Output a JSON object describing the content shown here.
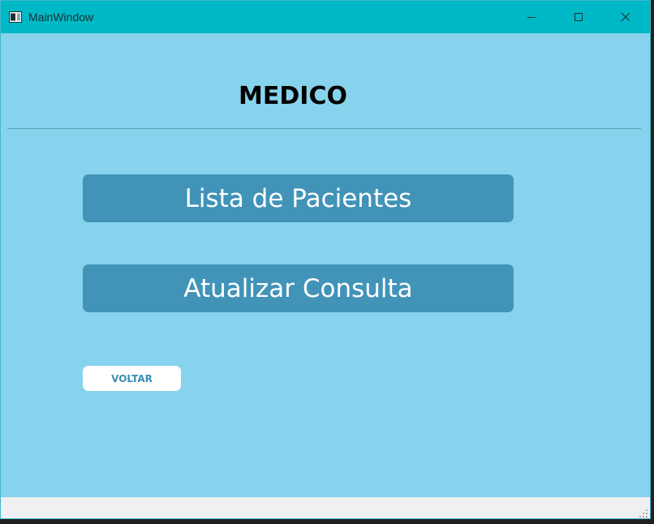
{
  "window": {
    "title": "MainWindow",
    "controls": {
      "minimize_icon": "minimize-icon",
      "maximize_icon": "maximize-icon",
      "close_icon": "close-icon"
    }
  },
  "main": {
    "heading": "MEDICO",
    "buttons": {
      "lista_label": "Lista de Pacientes",
      "atualizar_label": "Atualizar Consulta",
      "voltar_label": "VOLTAR"
    }
  },
  "colors": {
    "titlebar": "#00b9c6",
    "background": "#87d3ed",
    "button": "#4193b8",
    "back_button_text": "#3a8fb6",
    "statusbar": "#f0eff2"
  }
}
